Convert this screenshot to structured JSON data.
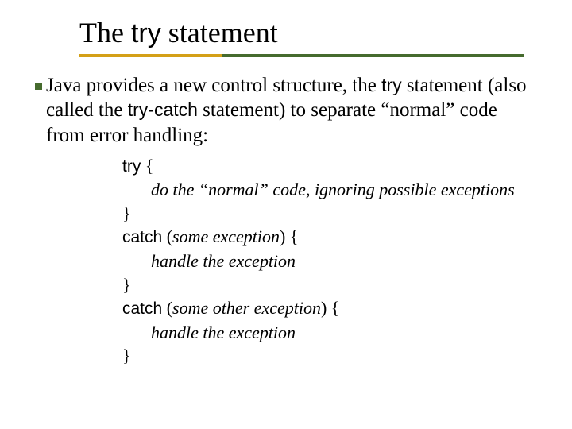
{
  "title": {
    "pre": "The ",
    "kw": "try",
    "post": " statement"
  },
  "para": {
    "t1": "Java provides a new control structure, the ",
    "kw1": "try",
    "t2": " statement (also called the ",
    "kw2": "try-catch",
    "t3": " statement) to separate “normal” code from error handling:"
  },
  "code": {
    "l1_kw": "try",
    "l1_brace": " {",
    "l2": "do the “normal” code, ignoring possible exceptions",
    "l3": "}",
    "l4_kw": "catch",
    "l4_open": " (",
    "l4_arg": "some exception",
    "l4_close": ") {",
    "l5": "handle the exception",
    "l6": "}",
    "l7_kw": "catch",
    "l7_open": " (",
    "l7_arg": "some other exception",
    "l7_close": ") {",
    "l8": "handle the exception",
    "l9": "}"
  }
}
